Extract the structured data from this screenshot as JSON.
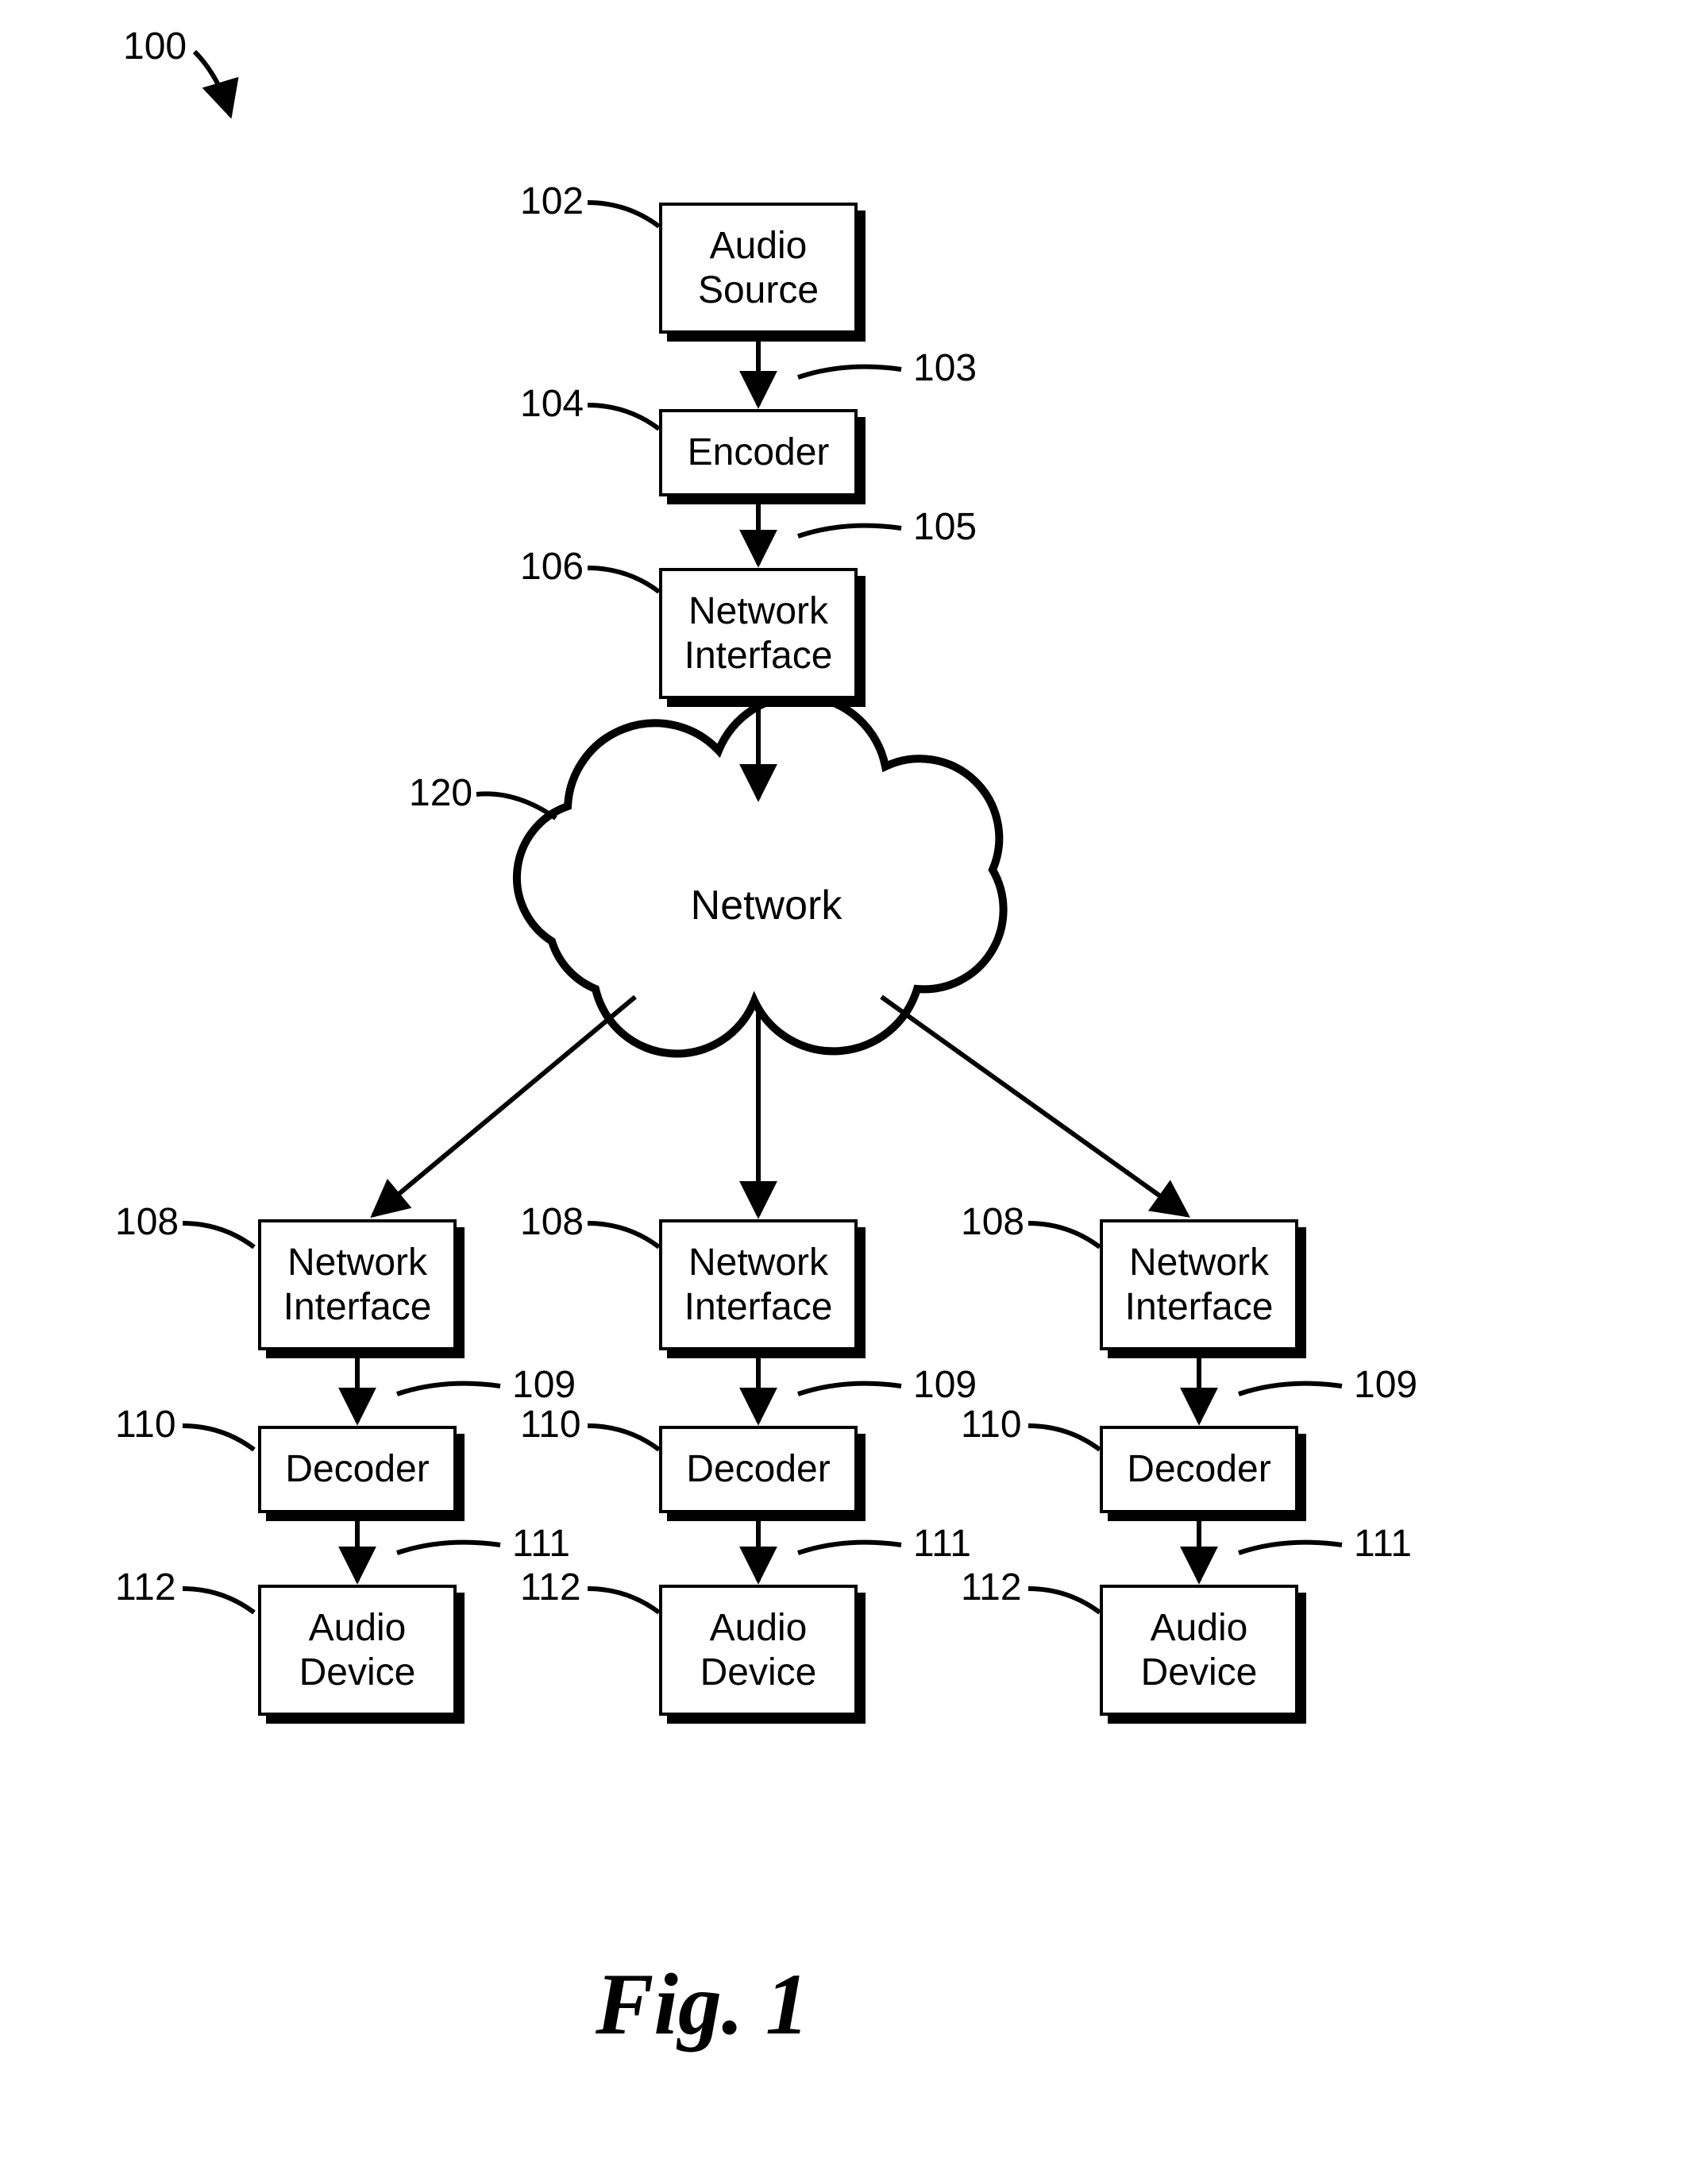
{
  "figure": {
    "system_ref": "100",
    "caption": "Fig. 1"
  },
  "nodes": {
    "audio_source": {
      "ref": "102",
      "label": "Audio\nSource"
    },
    "encoder": {
      "ref": "104",
      "label": "Encoder"
    },
    "net_if_tx": {
      "ref": "106",
      "label": "Network\nInterface"
    },
    "network": {
      "ref": "120",
      "label": "Network"
    },
    "net_if_rx": {
      "ref": "108",
      "label": "Network\nInterface"
    },
    "decoder": {
      "ref": "110",
      "label": "Decoder"
    },
    "audio_device": {
      "ref": "112",
      "label": "Audio\nDevice"
    }
  },
  "signals": {
    "src_to_enc": {
      "ref": "103"
    },
    "enc_to_nif": {
      "ref": "105"
    },
    "nif_to_dec": {
      "ref": "109"
    },
    "dec_to_dev": {
      "ref": "111"
    }
  }
}
